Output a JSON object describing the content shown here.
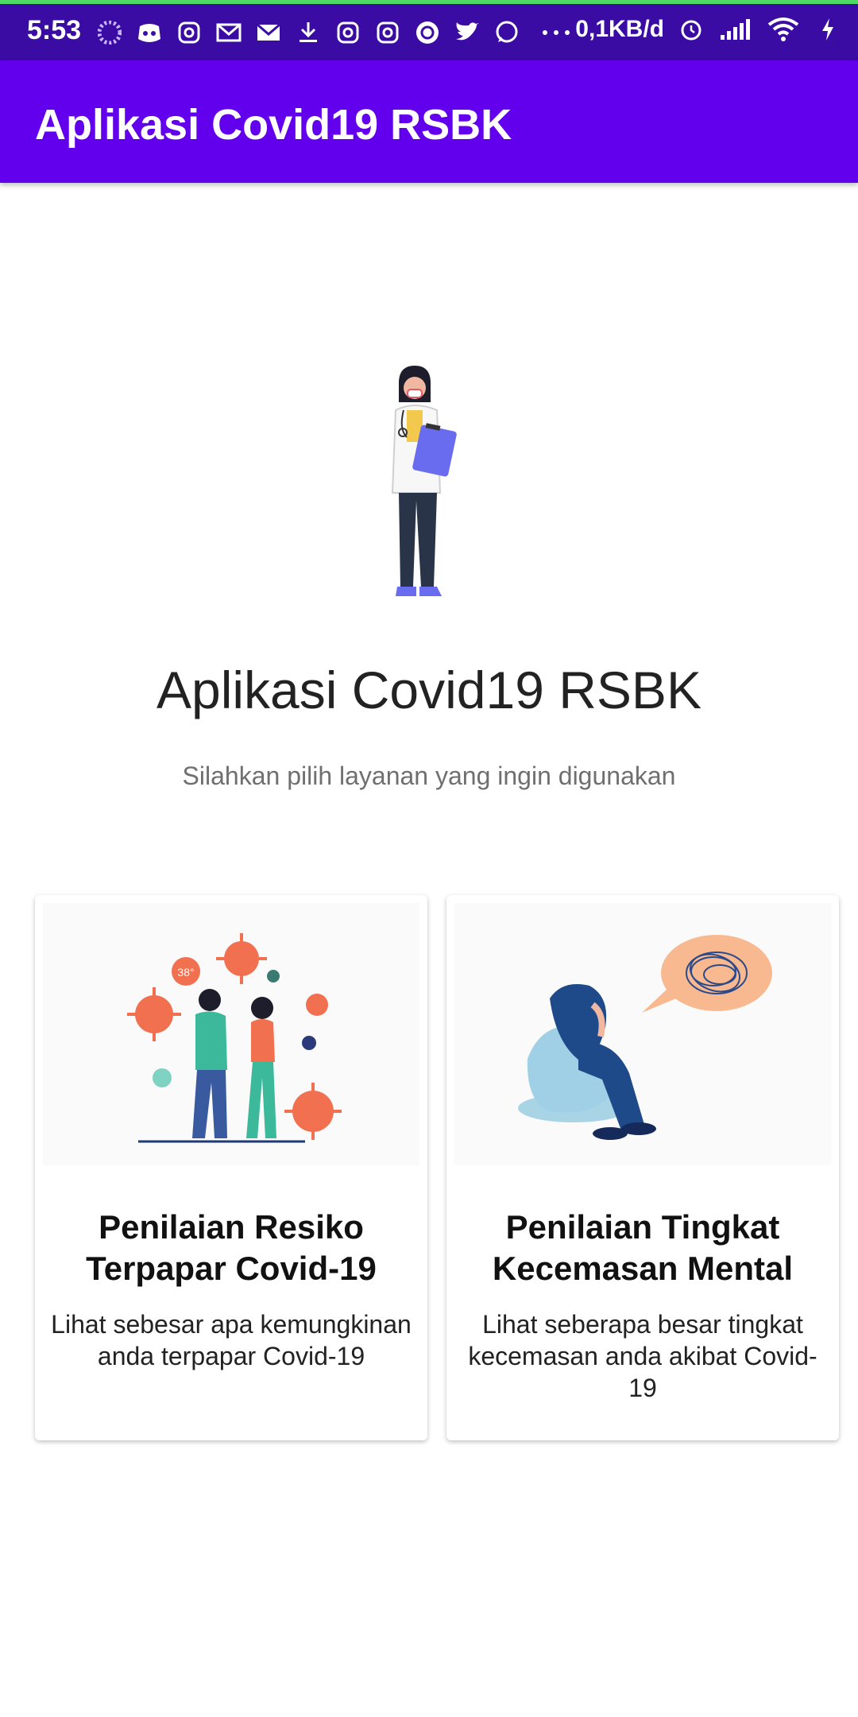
{
  "status_bar": {
    "time": "5:53",
    "network_speed": "0,1KB/d",
    "left_icons": [
      "loader-icon",
      "discord-icon",
      "instagram-icon",
      "gmail-icon",
      "gmail-icon",
      "download-icon",
      "instagram-icon",
      "instagram-icon",
      "sync-icon",
      "twitter-icon",
      "whatsapp-icon",
      "more-dots-icon"
    ],
    "right_icons": [
      "alarm-icon",
      "signal-icon",
      "wifi-icon",
      "charging-icon"
    ]
  },
  "app_bar": {
    "title": "Aplikasi Covid19 RSBK",
    "color": "#6200ee"
  },
  "main": {
    "title": "Aplikasi Covid19 RSBK",
    "subtitle": "Silahkan pilih layanan yang ingin digunakan"
  },
  "cards": [
    {
      "title": "Penilaian Resiko Terpapar Covid-19",
      "description": "Lihat sebesar apa kemungkinan anda terpapar Covid-19",
      "illustration": "virus-exposure-illustration",
      "badge_text": "38°"
    },
    {
      "title": "Penilaian Tingkat Kecemasan Mental",
      "description": "Lihat seberapa besar tingkat kecemasan anda akibat Covid-19",
      "illustration": "anxiety-illustration"
    }
  ]
}
